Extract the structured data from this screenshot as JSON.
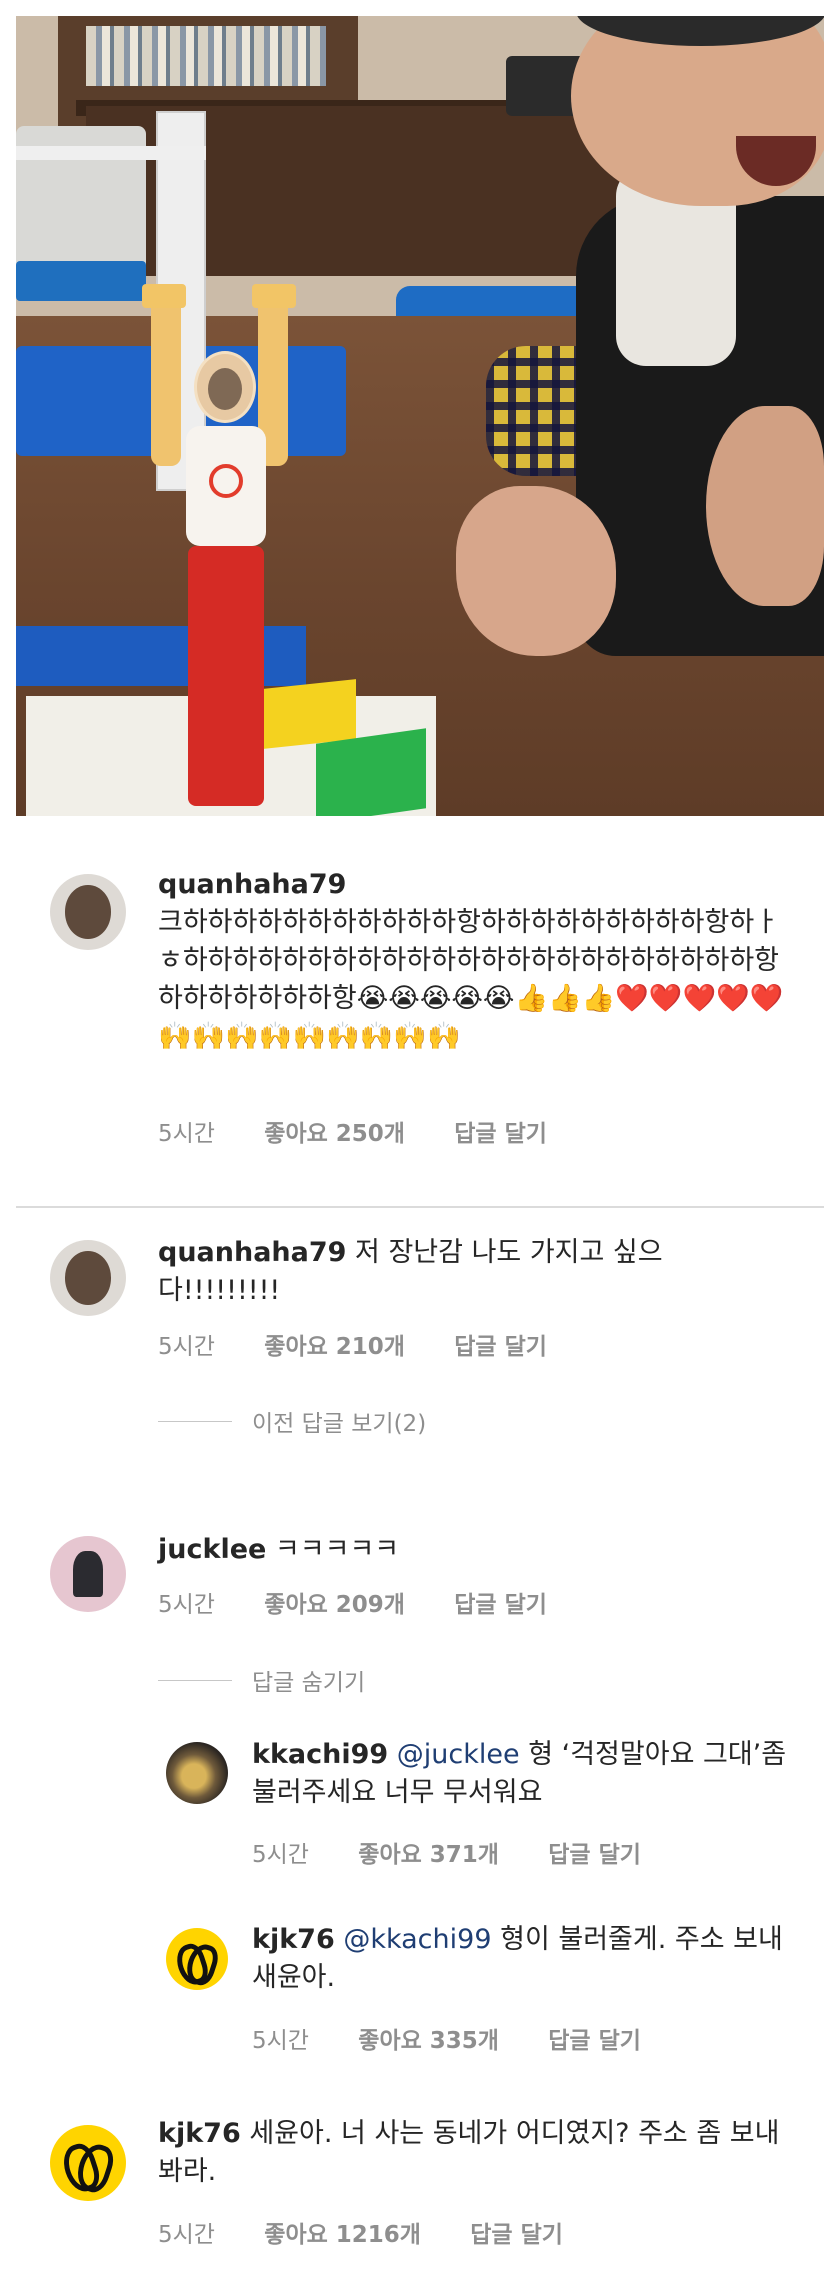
{
  "comments": [
    {
      "username": "quanhaha79",
      "text": "크하하하하하하하하하하하항하하하하하하하하하항하ㅏㅎ하하하하하하하하하하하하하하하하하하하하하하하항하하하하하하하항😭😭😭😭😭👍👍👍❤️❤️❤️❤️❤️🙌🙌🙌🙌🙌🙌🙌🙌🙌",
      "time": "5시간",
      "likes": "좋아요 250개",
      "reply": "답글 달기"
    },
    {
      "username": "quanhaha79",
      "text": "저 장난감 나도 가지고 싶으다!!!!!!!!!",
      "time": "5시간",
      "likes": "좋아요 210개",
      "reply": "답글 달기"
    },
    {
      "username": "jucklee",
      "text": "ㅋㅋㅋㅋㅋ",
      "time": "5시간",
      "likes": "좋아요 209개",
      "reply": "답글 달기"
    },
    {
      "username": "kkachi99",
      "mention": "@jucklee",
      "text": "형 ‘걱정말아요 그대’좀 불러주세요 너무 무서워요",
      "time": "5시간",
      "likes": "좋아요 371개",
      "reply": "답글 달기"
    },
    {
      "username": "kjk76",
      "mention": "@kkachi99",
      "text": "형이 불러줄게. 주소 보내 새윤아.",
      "time": "5시간",
      "likes": "좋아요 335개",
      "reply": "답글 달기"
    },
    {
      "username": "kjk76",
      "text": "세윤아. 너 사는 동네가 어디였지? 주소 좀 보내봐라.",
      "time": "5시간",
      "likes": "좋아요 1216개",
      "reply": "답글 달기"
    }
  ],
  "thread_toggles": {
    "view_previous": "이전 답글 보기(2)",
    "hide_replies": "답글 숨기기"
  },
  "photo": {
    "text": ""
  }
}
